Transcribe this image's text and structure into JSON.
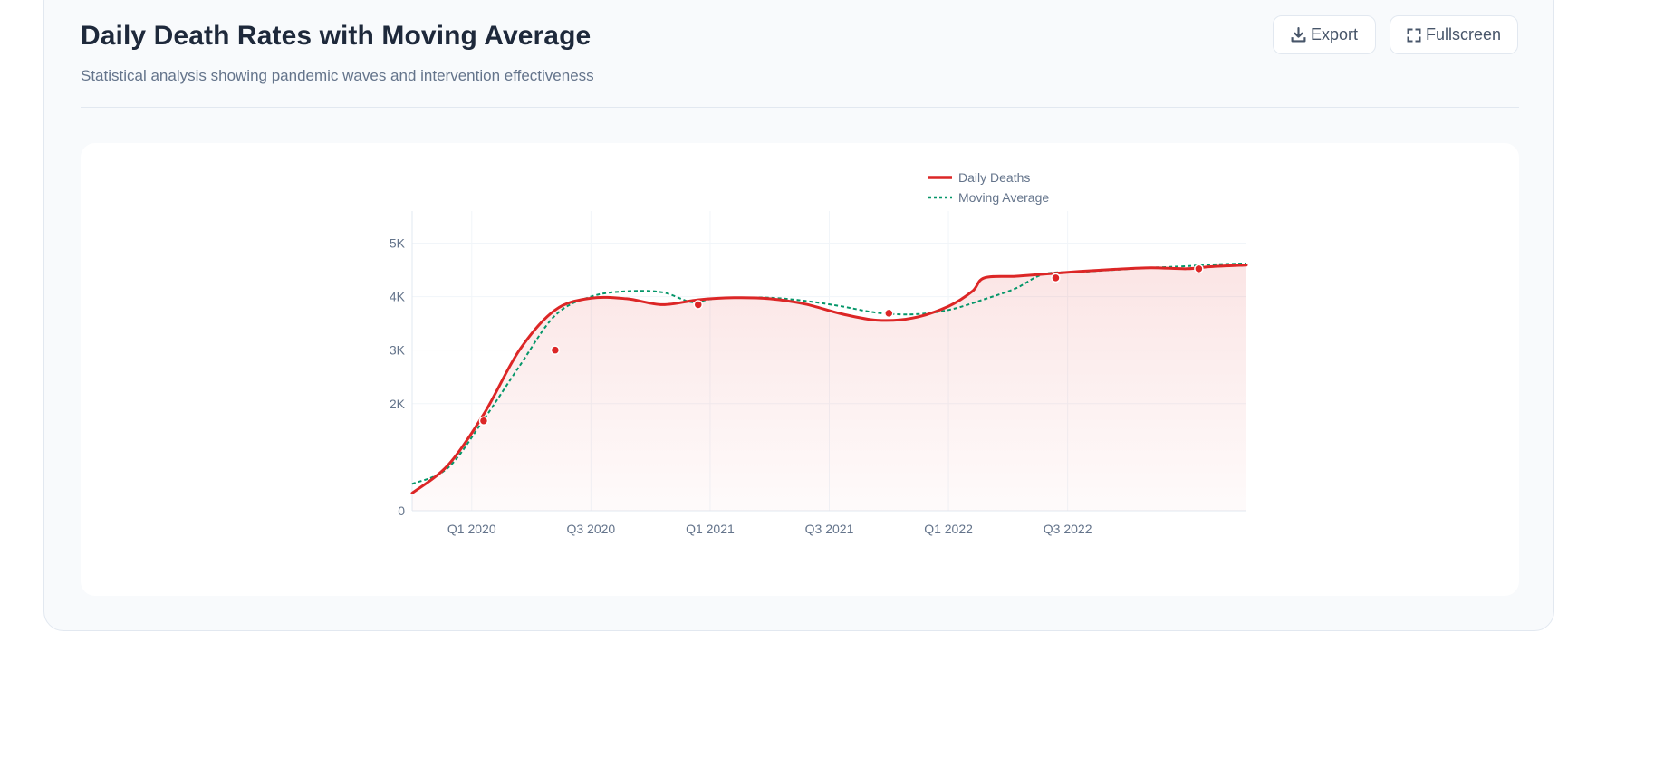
{
  "header": {
    "title": "Daily Death Rates with Moving Average",
    "subtitle": "Statistical analysis showing pandemic waves and intervention effectiveness"
  },
  "toolbar": {
    "export_label": "Export",
    "export_icon": "download-icon",
    "fullscreen_label": "Fullscreen",
    "fullscreen_icon": "fullscreen-icon"
  },
  "chart_data": {
    "type": "line",
    "title": "",
    "xlabel": "",
    "ylabel": "",
    "x_range": [
      2019.75,
      2023.25
    ],
    "ylim": [
      0,
      5600
    ],
    "y_ticks": [
      0,
      2000,
      3000,
      4000,
      5000
    ],
    "y_tick_labels": [
      "0",
      "2K",
      "3K",
      "4K",
      "5K"
    ],
    "x_ticks": [
      2020.0,
      2020.5,
      2021.0,
      2021.5,
      2022.0,
      2022.5
    ],
    "x_tick_labels": [
      "Q1 2020",
      "Q3 2020",
      "Q1 2021",
      "Q3 2021",
      "Q1 2022",
      "Q3 2022"
    ],
    "grid": true,
    "legend_position": "top-right",
    "series": [
      {
        "name": "Daily Deaths",
        "color": "#dc2626",
        "style": "solid",
        "area_fill": true,
        "x": [
          2019.75,
          2019.9,
          2020.05,
          2020.2,
          2020.35,
          2020.5,
          2020.65,
          2020.8,
          2020.95,
          2021.1,
          2021.25,
          2021.4,
          2021.55,
          2021.7,
          2021.85,
          2022.0,
          2022.1,
          2022.15,
          2022.28,
          2022.4,
          2022.55,
          2022.7,
          2022.85,
          2023.0,
          2023.1,
          2023.25
        ],
        "y": [
          330,
          850,
          1800,
          3000,
          3750,
          3970,
          3960,
          3850,
          3940,
          3980,
          3960,
          3860,
          3680,
          3560,
          3600,
          3820,
          4100,
          4350,
          4380,
          4420,
          4470,
          4510,
          4540,
          4520,
          4560,
          4590
        ],
        "markers": [
          {
            "x": 2020.05,
            "y": 1680
          },
          {
            "x": 2020.35,
            "y": 3000
          },
          {
            "x": 2020.95,
            "y": 3850
          },
          {
            "x": 2021.75,
            "y": 3690
          },
          {
            "x": 2022.45,
            "y": 4350
          },
          {
            "x": 2023.05,
            "y": 4520
          }
        ]
      },
      {
        "name": "Moving Average",
        "color": "#059669",
        "style": "dashed",
        "area_fill": false,
        "x": [
          2019.75,
          2019.9,
          2020.05,
          2020.2,
          2020.35,
          2020.5,
          2020.65,
          2020.8,
          2020.92,
          2021.0,
          2021.1,
          2021.25,
          2021.4,
          2021.55,
          2021.7,
          2021.85,
          2022.0,
          2022.15,
          2022.28,
          2022.4,
          2022.55,
          2022.7,
          2022.85,
          2023.0,
          2023.1,
          2023.25
        ],
        "y": [
          500,
          800,
          1700,
          2700,
          3650,
          4000,
          4100,
          4080,
          3900,
          3950,
          3980,
          3980,
          3920,
          3820,
          3700,
          3670,
          3750,
          3950,
          4150,
          4420,
          4460,
          4500,
          4540,
          4570,
          4600,
          4620
        ]
      }
    ]
  }
}
